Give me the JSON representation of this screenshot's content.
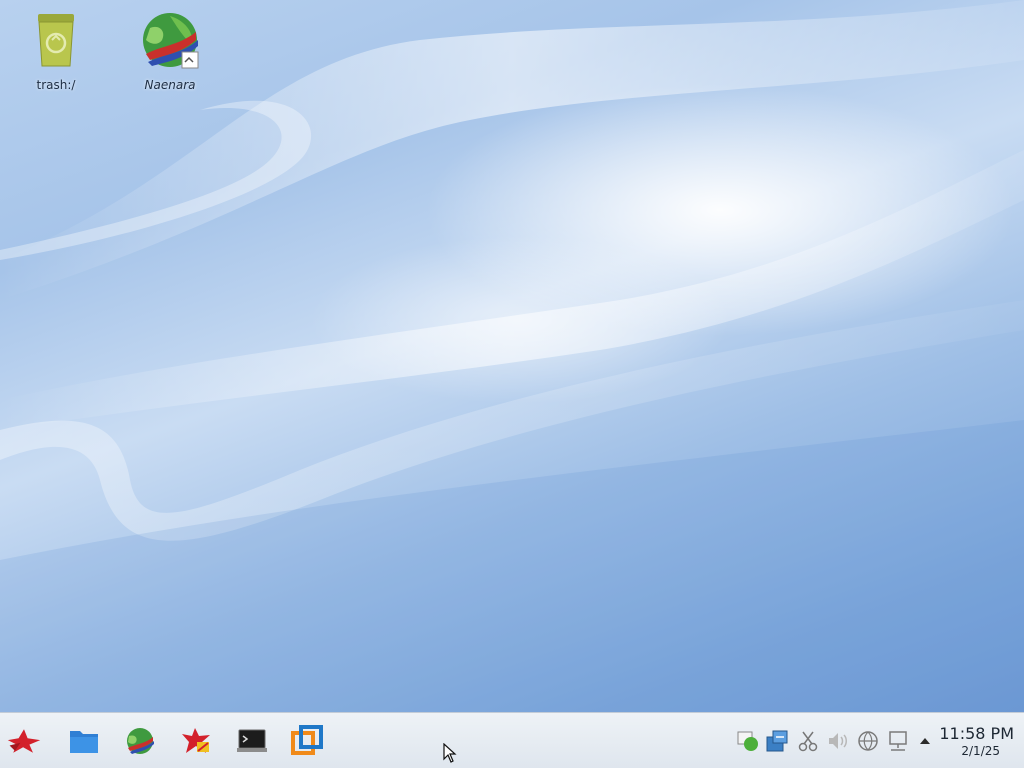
{
  "desktop": {
    "icons": [
      {
        "label": "trash:/",
        "icon": "trash-bin-icon"
      },
      {
        "label": "Naenara",
        "icon": "globe-browser-icon"
      }
    ]
  },
  "taskbar": {
    "launchers": [
      {
        "icon": "start-menu-star-icon"
      },
      {
        "icon": "file-manager-folder-icon"
      },
      {
        "icon": "naenara-globe-icon"
      },
      {
        "icon": "office-suite-icon"
      },
      {
        "icon": "terminal-icon"
      },
      {
        "icon": "virtualbox-icon"
      }
    ],
    "tray": [
      {
        "icon": "chat-status-icon"
      },
      {
        "icon": "package-update-icon"
      },
      {
        "icon": "clipboard-scissors-icon"
      },
      {
        "icon": "volume-icon"
      },
      {
        "icon": "network-globe-icon"
      },
      {
        "icon": "network-computer-icon"
      },
      {
        "icon": "tray-expand-arrow-icon"
      }
    ],
    "clock": {
      "time": "11:58 PM",
      "date": "2/1/25"
    }
  },
  "colors": {
    "taskbar_bg": "#e8edf2",
    "desktop_blue": "#9fbfe6"
  }
}
